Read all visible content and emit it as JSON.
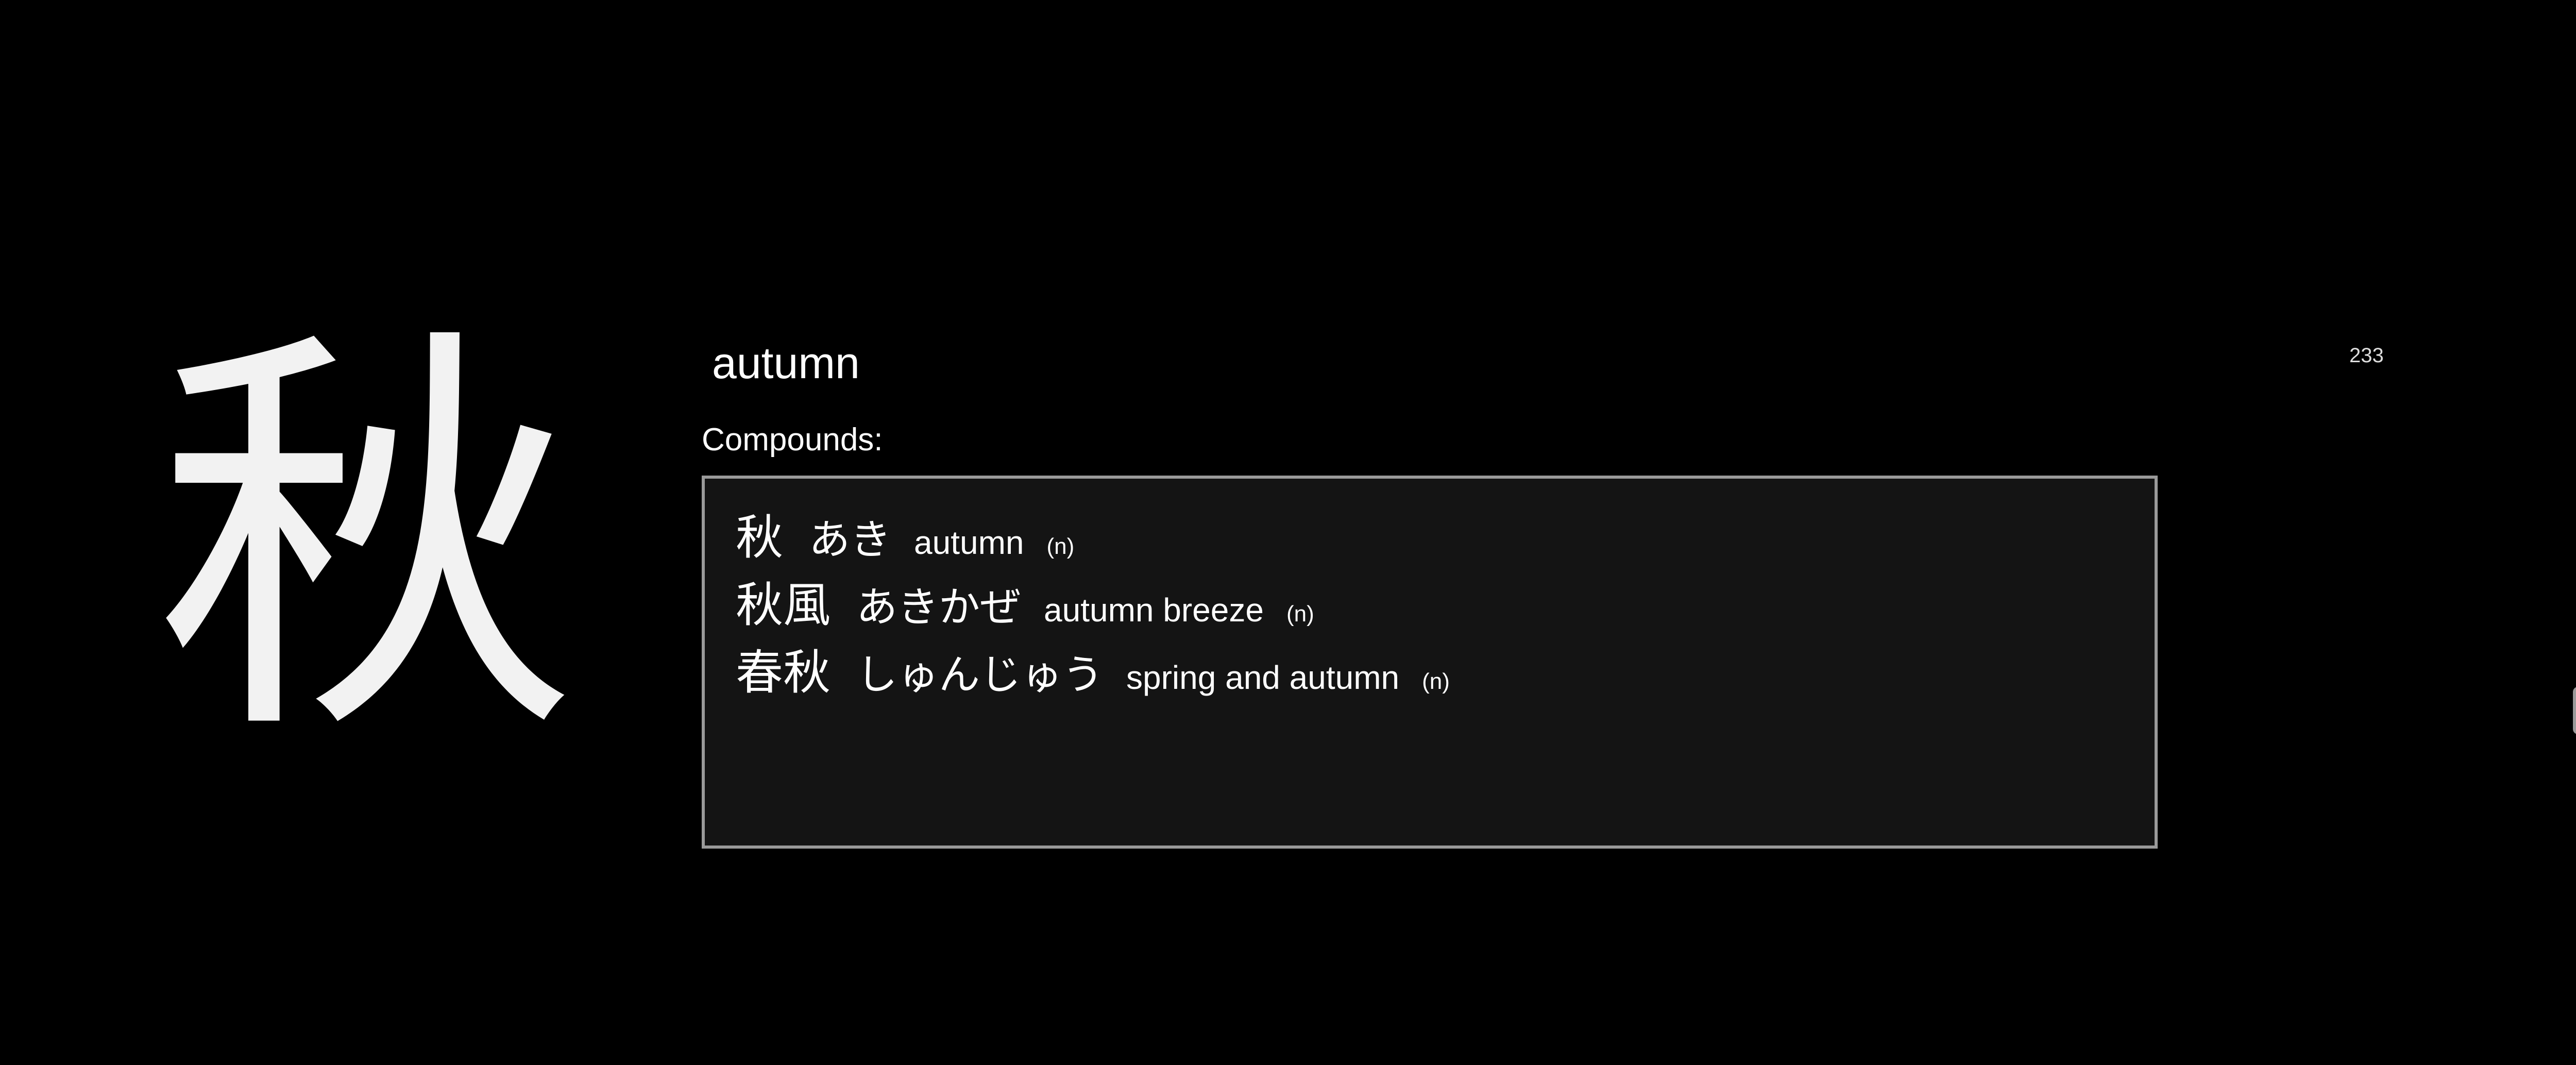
{
  "kanji": "秋",
  "meaning": "autumn",
  "counter": "233",
  "compounds_label": "Compounds:",
  "compounds": [
    {
      "word": "秋",
      "reading": "あき",
      "gloss": "autumn",
      "pos": "(n)"
    },
    {
      "word": "秋風",
      "reading": "あきかぜ",
      "gloss": "autumn breeze",
      "pos": "(n)"
    },
    {
      "word": "春秋",
      "reading": "しゅんじゅう",
      "gloss": "spring and autumn",
      "pos": "(n)"
    }
  ],
  "colors": {
    "background": "#000000",
    "box_background": "#141414",
    "box_border": "#9a9a9a",
    "text": "#ffffff"
  }
}
